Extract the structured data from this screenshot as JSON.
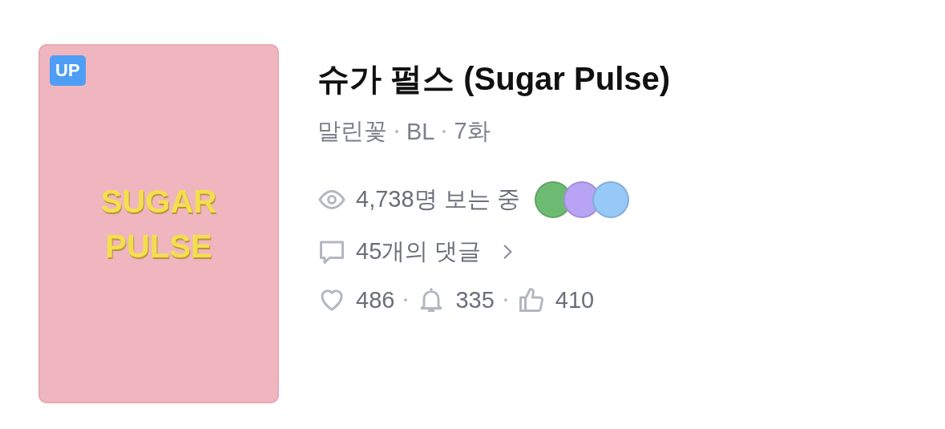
{
  "cover": {
    "badge": "UP",
    "title_lines": [
      "SUGAR",
      "PULSE"
    ]
  },
  "title": "슈가 펄스 (Sugar Pulse)",
  "meta": [
    "말린꽃",
    "BL",
    "7화"
  ],
  "viewers": {
    "text": "4,738명 보는 중",
    "avatars": [
      {
        "color": "#6dbb72"
      },
      {
        "color": "#b9a3f5"
      },
      {
        "color": "#96c8f8"
      }
    ]
  },
  "comments": {
    "text": "45개의 댓글"
  },
  "stats": [
    {
      "kind": "heart",
      "value": "486"
    },
    {
      "kind": "bell",
      "value": "335"
    },
    {
      "kind": "thumb",
      "value": "410"
    }
  ]
}
